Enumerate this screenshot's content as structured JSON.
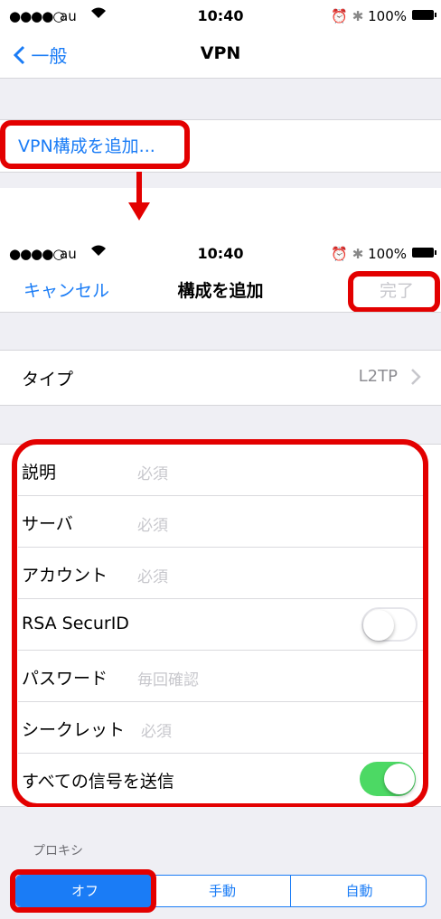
{
  "top_screen": {
    "status": {
      "carrier": "au",
      "time": "10:40",
      "battery": "100%"
    },
    "nav": {
      "back_label": "一般",
      "title": "VPN"
    },
    "add_vpn_label": "VPN構成を追加..."
  },
  "bottom_screen": {
    "status": {
      "carrier": "au",
      "time": "10:40",
      "battery": "100%"
    },
    "nav": {
      "cancel_label": "キャンセル",
      "title": "構成を追加",
      "done_label": "完了"
    },
    "type_row": {
      "label": "タイプ",
      "value": "L2TP"
    },
    "fields": [
      {
        "label": "説明",
        "placeholder": "必須"
      },
      {
        "label": "サーバ",
        "placeholder": "必須"
      },
      {
        "label": "アカウント",
        "placeholder": "必須"
      },
      {
        "label": "RSA SecurID",
        "toggle": false
      },
      {
        "label": "パスワード",
        "placeholder": "毎回確認"
      },
      {
        "label": "シークレット",
        "placeholder": "必須"
      },
      {
        "label": "すべての信号を送信",
        "toggle": true
      }
    ],
    "proxy": {
      "header": "プロキシ",
      "options": [
        "オフ",
        "手動",
        "自動"
      ],
      "selected": "オフ"
    }
  },
  "colors": {
    "accent": "#1a7cf6",
    "highlight": "#e30000",
    "toggle_on": "#4cd964"
  }
}
